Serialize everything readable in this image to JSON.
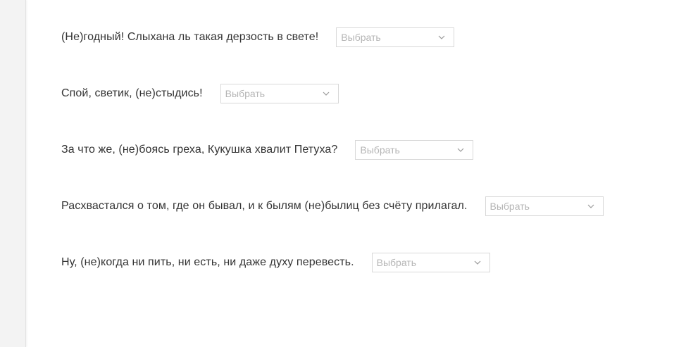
{
  "quiz": {
    "select_placeholder": "Выбрать",
    "questions": [
      {
        "text": "(Не)годный! Слыхана ль такая дерзость в свете!"
      },
      {
        "text": "Спой, светик, (не)стыдись!"
      },
      {
        "text": "За что же, (не)боясь греха, Кукушка хвалит Петуха?"
      },
      {
        "text": "Расхвастался о том, где он бывал, и к былям (не)былиц без счёту прилагал."
      },
      {
        "text": "Ну, (не)когда ни пить, ни есть, ни даже духу перевесть."
      }
    ]
  },
  "icons": {
    "dropdown": "chevron-down-icon"
  },
  "colors": {
    "text": "#333333",
    "placeholder": "#b5b5b5",
    "border": "#d8d8d8",
    "gutter": "#f3f3f3"
  }
}
